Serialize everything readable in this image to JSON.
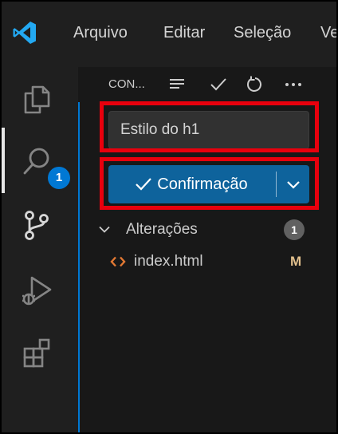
{
  "menubar": {
    "items": [
      {
        "label": "Arquivo"
      },
      {
        "label": "Editar"
      },
      {
        "label": "Seleção"
      },
      {
        "label": "Ve"
      }
    ]
  },
  "activity_bar": {
    "items": [
      {
        "name": "explorer",
        "icon": "files-icon"
      },
      {
        "name": "search",
        "icon": "search-icon"
      },
      {
        "name": "source-control",
        "icon": "source-control-icon",
        "badge": "1",
        "active": true
      },
      {
        "name": "run-debug",
        "icon": "run-debug-icon"
      },
      {
        "name": "extensions",
        "icon": "extensions-icon"
      }
    ]
  },
  "scm": {
    "header_title": "CON...",
    "header_actions": [
      "view-as-list-icon",
      "commit-check-icon",
      "refresh-icon",
      "more-actions-icon"
    ],
    "commit_message": "Estilo do h1",
    "commit_button_label": "Confirmação",
    "changes": {
      "label": "Alterações",
      "count": "1",
      "files": [
        {
          "name": "index.html",
          "status": "M",
          "icon": "html-file-icon"
        }
      ]
    }
  },
  "colors": {
    "accent": "#0078d4",
    "commit_button": "#0e639c",
    "highlight_border": "#e8000d",
    "modified": "#e2c08d",
    "html_icon": "#e37933"
  }
}
